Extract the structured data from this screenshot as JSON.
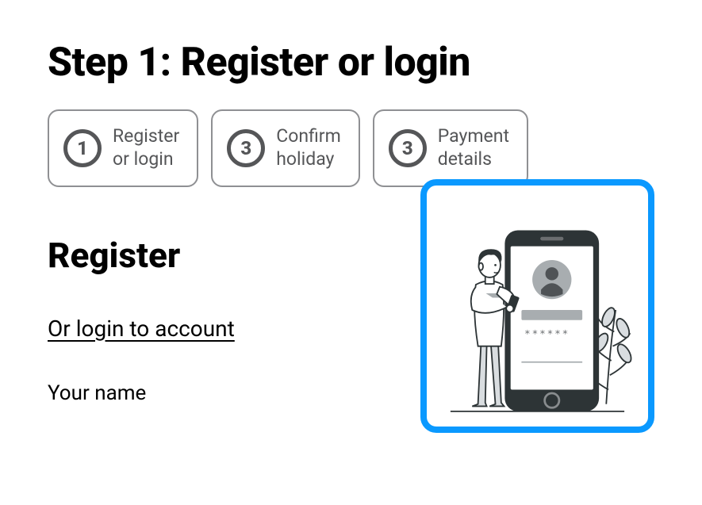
{
  "page_title": "Step 1: Register or login",
  "steps": [
    {
      "num": "1",
      "label": "Register\nor login"
    },
    {
      "num": "3",
      "label": "Confirm\nholiday"
    },
    {
      "num": "3",
      "label": "Payment\ndetails"
    }
  ],
  "form": {
    "heading": "Register",
    "login_link": "Or login to account",
    "name_label": "Your name"
  }
}
